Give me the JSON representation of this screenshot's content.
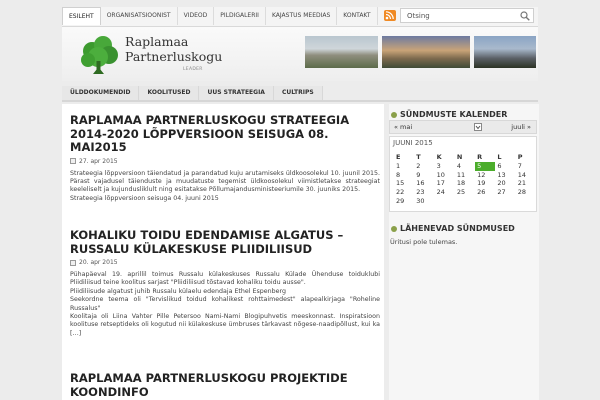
{
  "topnav": {
    "items": [
      "ESILEHT",
      "ORGANISATSIOONIST",
      "VIDEOD",
      "PILDIGALERII",
      "KAJASTUS MEEDIAS",
      "KONTAKT"
    ]
  },
  "search": {
    "value": "Otsing"
  },
  "logo": {
    "line1": "Raplamaa",
    "line2": "Partnerluskogu",
    "sub": "LEADER"
  },
  "mainnav": {
    "items": [
      "ÜLDDOKUMENDID",
      "KOOLITUSED",
      "UUS STRATEEGIA",
      "CULTRIPS"
    ]
  },
  "posts": [
    {
      "title": "RAPLAMAA PARTNERLUSKOGU STRATEEGIA 2014-2020 LÕPPVERSIOON SEISUGA 08. MAI2015",
      "date": "27. apr 2015",
      "lines": [
        "Strateegia lõppversioon täiendatud ja parandatud kuju arutamiseks üldkoosolekul 10. juunil 2015. Pärast vajadusel täienduste ja muudatuste tegemist üldkoosolekul viimistletakse strateegiat keeleliselt ja kujundusliklult ning esitatakse Põllumajandusministeeriumile 30. juuniks 2015.",
        "Strateegia lõppversioon seisuga 04. juuni 2015"
      ]
    },
    {
      "title": "KOHALIKU TOIDU EDENDAMISE ALGATUS – RUSSALU KÜLAKESKUSE PLIIDILIISUD",
      "date": "20. apr 2015",
      "lines": [
        "Pühapäeval 19. aprillil toimus Russalu külakeskuses Russalu Külade Ühenduse toiduklubi Pliidiliisud teine koolitus sarjast \"Pliidiliisud tõstavad kohaliku toidu ausse\".",
        "Pliidiliisude algatust juhib Russalu külaelu edendaja Ethel Espenberg",
        "Seekordne teema oli \"Tervislikud toidud kohalikest rohttaimedest\" alapealkirjaga \"Roheline Russalus\"",
        "Koolitaja oli Liina Vahter Pille Petersoo Nami-Nami Blogipuhvetis meeskonnast. Inspiratsioon koolituse retseptideks oli kogutud nii külakeskuse ümbruses tärkavast nõgese-naadipõllust, kui ka […]"
      ]
    },
    {
      "title": "RAPLAMAA PARTNERLUSKOGU PROJEKTIDE KOONDINFO"
    }
  ],
  "sidebar": {
    "calendar_title": "SÜNDMUSTE KALENDER",
    "prev": "« mai",
    "next": "juuli »",
    "month": "JUUNI 2015",
    "weekdays": [
      "E",
      "T",
      "K",
      "N",
      "R",
      "L",
      "P"
    ],
    "weeks": [
      [
        "1",
        "2",
        "3",
        "4",
        "5",
        "6",
        "7"
      ],
      [
        "8",
        "9",
        "10",
        "11",
        "12",
        "13",
        "14"
      ],
      [
        "15",
        "16",
        "17",
        "18",
        "19",
        "20",
        "21"
      ],
      [
        "22",
        "23",
        "24",
        "25",
        "26",
        "27",
        "28"
      ],
      [
        "29",
        "30",
        "",
        "",
        "",
        "",
        ""
      ]
    ],
    "today": "5",
    "upcoming_title": "LÄHENEVAD SÜNDMUSED",
    "upcoming_empty": "Üritusi pole tulemas."
  }
}
